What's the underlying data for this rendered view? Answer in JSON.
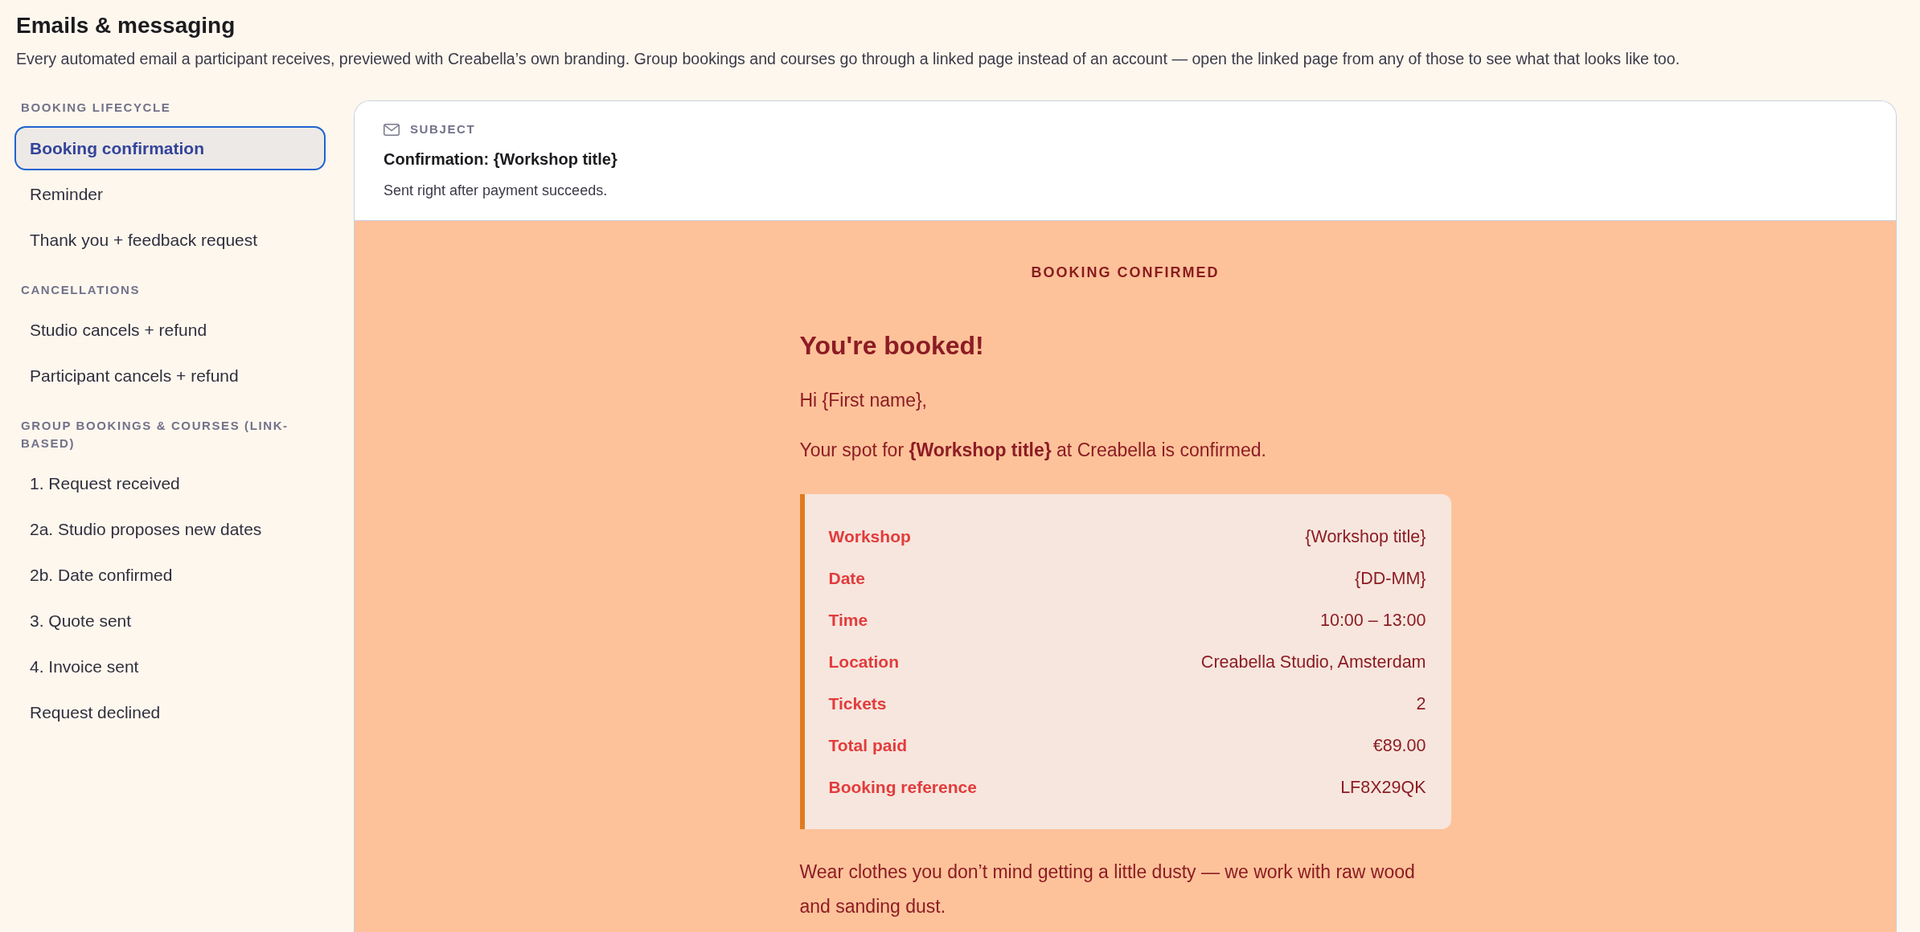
{
  "header": {
    "title": "Emails & messaging",
    "description": "Every automated email a participant receives, previewed with Creabella’s own branding. Group bookings and courses go through a linked page instead of an account — open the linked page from any of those to see what that looks like too."
  },
  "sidebar": {
    "sections": [
      {
        "heading": "BOOKING LIFECYCLE",
        "items": [
          {
            "label": "Booking confirmation",
            "selected": true
          },
          {
            "label": "Reminder",
            "selected": false
          },
          {
            "label": "Thank you + feedback request",
            "selected": false
          }
        ]
      },
      {
        "heading": "CANCELLATIONS",
        "items": [
          {
            "label": "Studio cancels + refund",
            "selected": false
          },
          {
            "label": "Participant cancels + refund",
            "selected": false
          }
        ]
      },
      {
        "heading": "GROUP BOOKINGS & COURSES (LINK-BASED)",
        "items": [
          {
            "label": "1. Request received",
            "selected": false
          },
          {
            "label": "2a. Studio proposes new dates",
            "selected": false
          },
          {
            "label": "2b. Date confirmed",
            "selected": false
          },
          {
            "label": "3. Quote sent",
            "selected": false
          },
          {
            "label": "4. Invoice sent",
            "selected": false
          },
          {
            "label": "Request declined",
            "selected": false
          }
        ]
      }
    ]
  },
  "preview": {
    "subject_label": "SUBJECT",
    "subject": "Confirmation: {Workshop title}",
    "note": "Sent right after payment succeeds.",
    "email": {
      "eyebrow": "BOOKING CONFIRMED",
      "heading": "You're booked!",
      "body": [
        {
          "kind": "paragraph",
          "text": "Hi {First name},"
        },
        {
          "kind": "paragraph",
          "text": "Your spot for **{Workshop title}** at Creabella is confirmed."
        },
        {
          "kind": "details",
          "rows": [
            {
              "label": "Workshop",
              "value": "{Workshop title}"
            },
            {
              "label": "Date",
              "value": "{DD-MM}"
            },
            {
              "label": "Time",
              "value": "10:00 – 13:00"
            },
            {
              "label": "Location",
              "value": "Creabella Studio, Amsterdam"
            },
            {
              "label": "Tickets",
              "value": "2"
            },
            {
              "label": "Total paid",
              "value": "€89.00"
            },
            {
              "label": "Booking reference",
              "value": "LF8X29QK"
            }
          ]
        },
        {
          "kind": "paragraph",
          "text": "Wear clothes you don’t mind getting a little dusty — we work with raw wood and sanding dust."
        }
      ]
    }
  }
}
